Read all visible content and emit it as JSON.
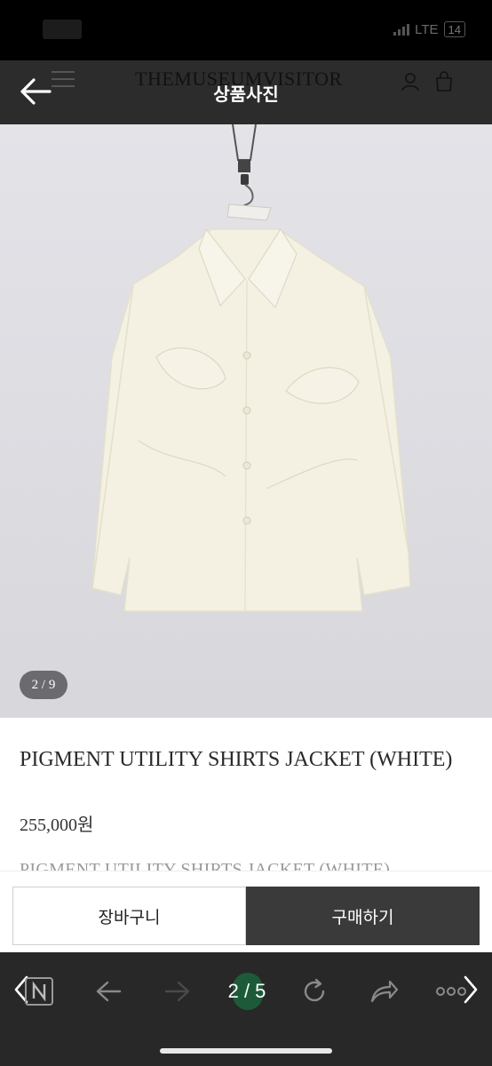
{
  "status_bar": {
    "network": "LTE",
    "battery": "14"
  },
  "site_header": {
    "brand": "THEMUSEUMVISITOR"
  },
  "viewer": {
    "title": "상품사진",
    "counter": "2 / 9"
  },
  "product": {
    "name": "PIGMENT UTILITY SHIRTS JACKET (WHITE)",
    "price": "255,000원",
    "sub_name": "PIGMENT UTILITY SHIRTS JACKET (WHITE)"
  },
  "actions": {
    "cart_label": "장바구니",
    "buy_label": "구매하기"
  },
  "browser": {
    "page_indicator": "2 / 5"
  },
  "colors": {
    "buy_button": "#3a3a3a",
    "photo_bg": "#dfdfe4",
    "jacket": "#f4f1e3",
    "page_indicator_bg": "#1d5a3a"
  }
}
